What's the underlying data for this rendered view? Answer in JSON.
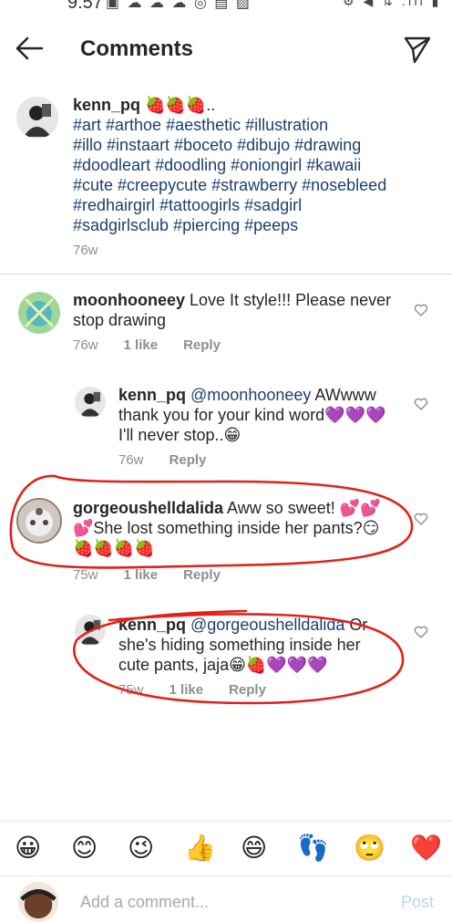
{
  "status_bar": {
    "time": "9:57",
    "left_icons": "▣ ☁ ☁ ☁ ◎ ▤ ▨",
    "right_icons": "⚙ ◀ ⇅ .ıll ▮"
  },
  "header": {
    "title": "Comments",
    "back_icon": "arrow-left-icon",
    "send_icon": "paper-plane-icon"
  },
  "caption": {
    "username": "kenn_pq",
    "lines": [
      " 🍓🍓🍓..",
      "#art #arthoe #aesthetic #illustration",
      "#illo #instaart #boceto #dibujo #drawing",
      "#doodleart #doodling #oniongirl #kawaii",
      "#cute #creepycute #strawberry #nosebleed",
      "#redhairgirl #tattoogirls #sadgirl",
      "#sadgirlsclub #piercing #peeps"
    ],
    "time": "76w"
  },
  "comments": [
    {
      "username": "moonhooneey",
      "line1": " Love It style!!! Please never",
      "line2": "stop drawing",
      "time": "76w",
      "likes": "1 like",
      "reply": "Reply"
    },
    {
      "username": "kenn_pq",
      "mention": " @moonhooneey",
      "line1_rest": "  AWwww",
      "line2": "thank you for your kind word💜💜💜",
      "line3": "I'll never stop..😁",
      "time": "76w",
      "reply": "Reply"
    },
    {
      "username": "gorgeoushelldalida",
      "line1": " Aww so sweet! 💕💕",
      "line2": "💕She lost something inside her pants?😏",
      "line3": "🍓🍓🍓🍓",
      "time": "75w",
      "likes": "1 like",
      "reply": "Reply"
    },
    {
      "username": "kenn_pq",
      "mention": " @gorgeoushelldalida",
      "line1_rest": " Or",
      "line2": "she's hiding something inside her",
      "line3": "cute pants, jaja😁🍓💜💜💜",
      "time": "75w",
      "likes": "1 like",
      "reply": "Reply"
    }
  ],
  "emoji_bar": [
    "😀",
    "😊",
    "😉",
    "👍",
    "😄",
    "👣",
    "🙄",
    "❤️"
  ],
  "composer": {
    "placeholder": "Add a comment...",
    "post": "Post"
  },
  "colors": {
    "hashtag": "#1c3f6e",
    "annotation_red": "#e0221b",
    "post_disabled": "#b3d6f5",
    "meta_gray": "#8e8e8e"
  }
}
